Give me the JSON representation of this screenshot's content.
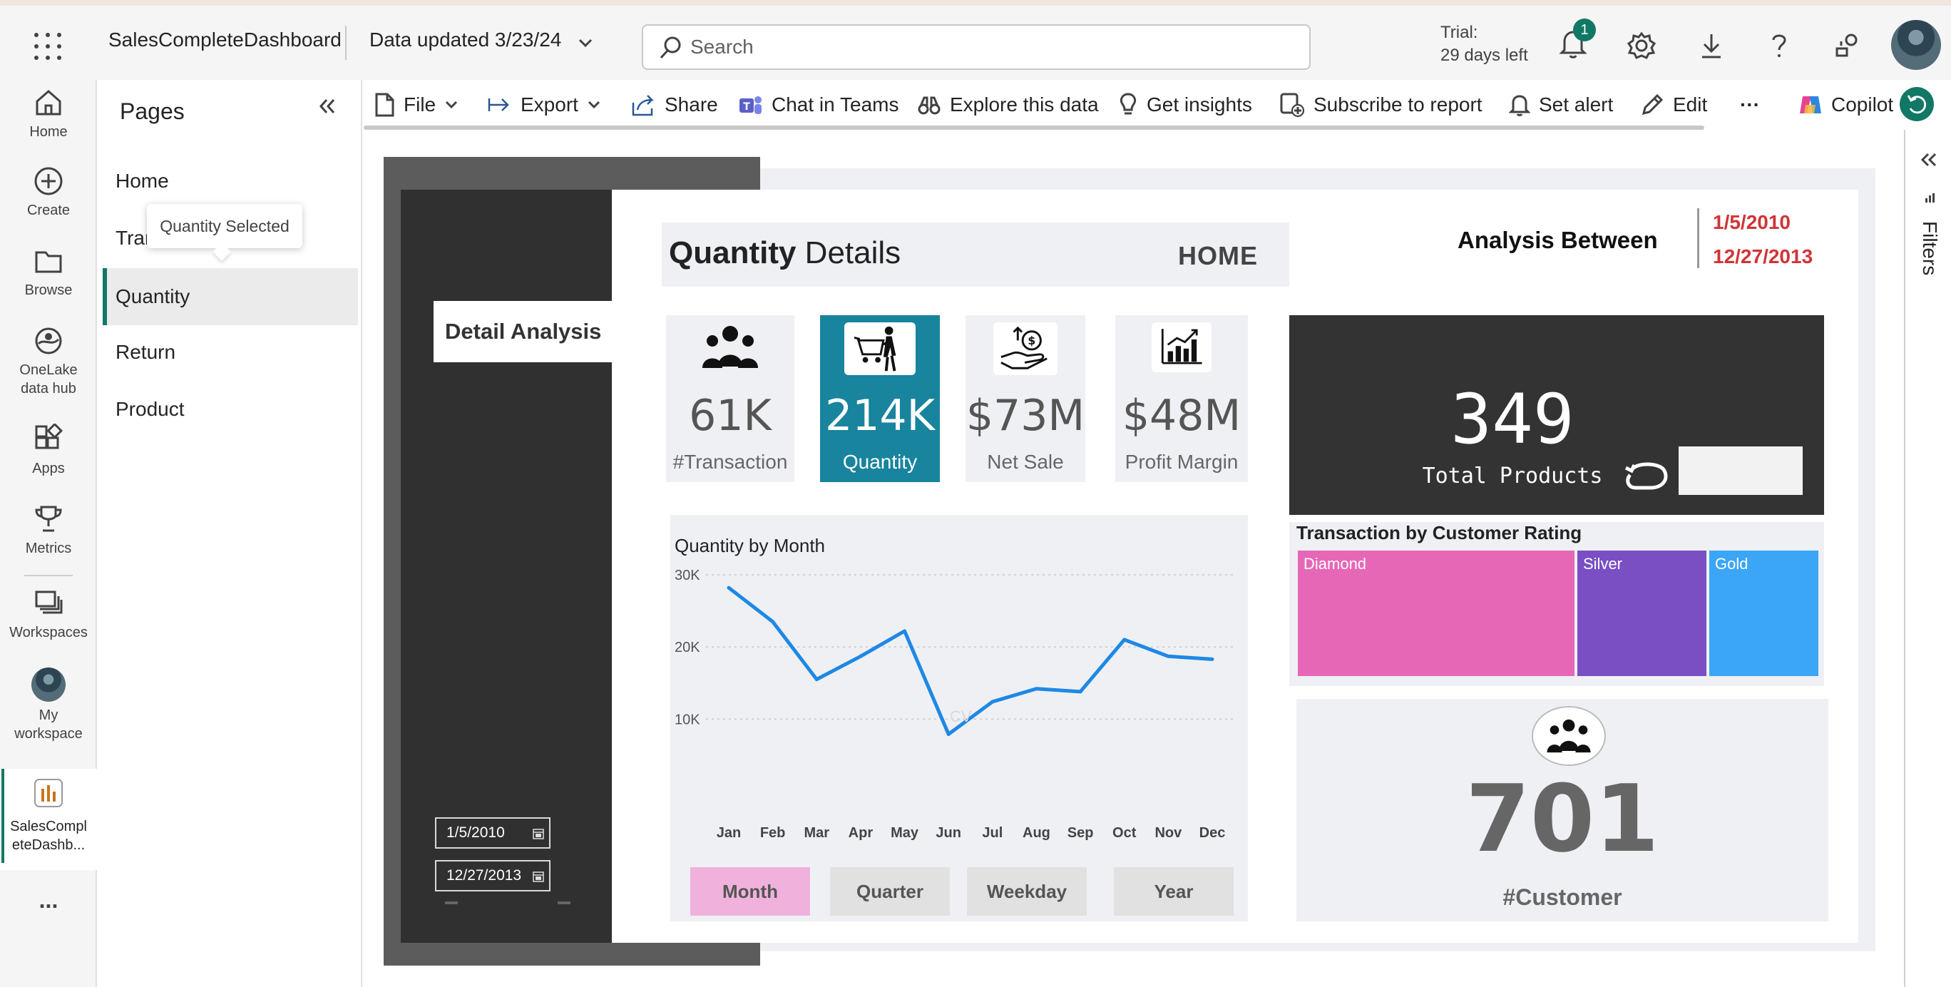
{
  "topbar": {
    "app_name": "SalesCompleteDashboard",
    "data_updated": "Data updated 3/23/24",
    "search_placeholder": "Search",
    "trial_line1": "Trial:",
    "trial_line2": "29 days left",
    "notification_count": "1"
  },
  "left_rail": {
    "items": [
      {
        "label": "Home",
        "icon": "home-icon"
      },
      {
        "label": "Create",
        "icon": "plus-circle-icon"
      },
      {
        "label": "Browse",
        "icon": "folder-icon"
      },
      {
        "label": "OneLake data hub",
        "line1": "OneLake",
        "line2": "data hub",
        "icon": "onelake-icon"
      },
      {
        "label": "Apps",
        "icon": "apps-icon"
      },
      {
        "label": "Metrics",
        "icon": "trophy-icon"
      },
      {
        "label": "Workspaces",
        "icon": "workspaces-icon"
      },
      {
        "label": "My workspace",
        "line1": "My",
        "line2": "workspace",
        "icon": "avatar-icon"
      },
      {
        "label": "SalesCompleteDashb...",
        "line1": "SalesCompl",
        "line2": "eteDashb...",
        "icon": "report-icon"
      }
    ],
    "more": "..."
  },
  "pages_pane": {
    "title": "Pages",
    "items": [
      "Home",
      "Tran",
      "Quantity",
      "Return",
      "Product"
    ],
    "selected": "Quantity",
    "tooltip": "Quantity Selected"
  },
  "command_bar": {
    "file": "File",
    "export": "Export",
    "share": "Share",
    "chat": "Chat in Teams",
    "explore": "Explore this data",
    "insights": "Get insights",
    "subscribe": "Subscribe to report",
    "alert": "Set alert",
    "edit": "Edit",
    "more": "···",
    "copilot": "Copilot"
  },
  "filters_label": "Filters",
  "report": {
    "detail_analysis": "Detail Analysis",
    "start_date": "1/5/2010",
    "end_date": "12/27/2013",
    "title_bold": "Quantity",
    "title_rest": " Details",
    "home_button": "HOME",
    "analysis_between": "Analysis Between",
    "range_start": "1/5/2010",
    "range_end": "12/27/2013",
    "kpis": [
      {
        "value": "61K",
        "label": "#Transaction"
      },
      {
        "value": "214K",
        "label": "Quantity"
      },
      {
        "value": "$73M",
        "label": "Net Sale"
      },
      {
        "value": "$48M",
        "label": "Profit Margin"
      }
    ],
    "total_products_value": "349",
    "total_products_label": "Total Products",
    "customer_value": "701",
    "customer_label": "#Customer",
    "buttons": [
      "Month",
      "Quarter",
      "Weekday",
      "Year"
    ],
    "active_button": "Month",
    "watermark": "CV"
  },
  "colors": {
    "accent_teal": "#117865",
    "kpi_highlight": "#18849e",
    "line": "#1e88e5",
    "diamond": "#e767b7",
    "silver": "#7a4fc4",
    "gold": "#3aa6f5",
    "month_active": "#f0b2dc",
    "date_red": "#d13438"
  },
  "chart_data": [
    {
      "type": "line",
      "title": "Quantity by Month",
      "categories": [
        "Jan",
        "Feb",
        "Mar",
        "Apr",
        "May",
        "Jun",
        "Jul",
        "Aug",
        "Sep",
        "Oct",
        "Nov",
        "Dec"
      ],
      "values": [
        28200,
        23500,
        15500,
        18700,
        22200,
        7900,
        12400,
        14200,
        13800,
        21000,
        18700,
        18300
      ],
      "yticks": [
        "30K",
        "20K",
        "10K"
      ],
      "ytick_values": [
        30000,
        20000,
        10000
      ],
      "ylim": [
        3500,
        30000
      ],
      "grid": true
    },
    {
      "type": "treemap",
      "title": "Transaction by Customer Rating",
      "categories": [
        "Diamond",
        "Silver",
        "Gold"
      ],
      "shares": [
        0.537,
        0.253,
        0.21
      ]
    }
  ]
}
